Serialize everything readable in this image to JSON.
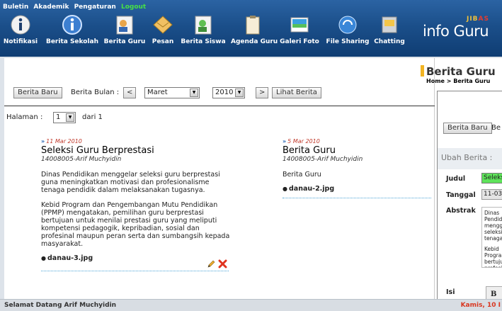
{
  "top_menu": {
    "items": [
      "Buletin",
      "Akademik",
      "Pengaturan"
    ],
    "logout": "Logout"
  },
  "nav": [
    {
      "label": "Notifikasi",
      "icon": "info-icon"
    },
    {
      "label": "Berita Sekolah",
      "icon": "info-circle-icon"
    },
    {
      "label": "Berita Guru",
      "icon": "teacher-news-icon"
    },
    {
      "label": "Pesan",
      "icon": "envelope-icon"
    },
    {
      "label": "Berita Siswa",
      "icon": "student-news-icon"
    },
    {
      "label": "Agenda Guru",
      "icon": "clipboard-icon"
    },
    {
      "label": "Galeri Foto",
      "icon": "photo-gallery-icon"
    },
    {
      "label": "File Sharing",
      "icon": "file-sharing-icon"
    },
    {
      "label": "Chatting",
      "icon": "chat-icon"
    }
  ],
  "logo": {
    "top": "JIB",
    "top_accent": "AS",
    "main": "info Guru"
  },
  "toolbar": {
    "berita_baru": "Berita Baru",
    "berita_bulan_label": "Berita Bulan :",
    "prev": "<",
    "month": "Maret",
    "year": "2010",
    "next": ">",
    "lihat_berita": "Lihat Berita"
  },
  "pagination": {
    "label": "Halaman :",
    "page": "1",
    "of": "dari 1"
  },
  "articles": [
    {
      "date": "11 Mar 2010",
      "title": "Seleksi Guru Berprestasi",
      "author": "14008005-Arif Muchyidin",
      "paragraphs": [
        "Dinas Pendidikan menggelar seleksi guru berprestasi guna meningkatkan motivasi dan profesionalisme tenaga pendidik dalam melaksanakan tugasnya.",
        "Kebid Program dan Pengembangan Mutu Pendidikan (PPMP) mengatakan, pemilihan guru berprestasi bertujuan untuk menilai prestasi guru yang meliputi kompetensi pedagogik, kepribadian, sosial dan profesinal maupun peran serta dan sumbangsih kepada masyarakat."
      ],
      "attachment": "danau-3.jpg"
    },
    {
      "date": "5 Mar 2010",
      "title": "Berita Guru",
      "author": "14008005-Arif Muchyidin",
      "paragraphs": [
        "Berita Guru"
      ],
      "attachment": "danau-2.jpg"
    }
  ],
  "right": {
    "title": "Berita Guru",
    "breadcrumb": "Home >  Berita Guru",
    "berita_baru": "Berita Baru",
    "berita_bulan_cut": "Be",
    "ubah_berita": "Ubah Berita :",
    "judul_label": "Judul",
    "judul_value": "Seleksi",
    "tanggal_label": "Tanggal",
    "tanggal_value": "11-03",
    "abstrak_label": "Abstrak",
    "abstrak_text_1": "Dinas Pendidikan menggelar seleksi tenaga",
    "abstrak_text_2": "Kebid Program bertujuan profesional",
    "isi_label": "Isi",
    "editor_bold": "B"
  },
  "footer": {
    "welcome": "Selamat Datang Arif Muchyidin",
    "date": "Kamis, 10 I"
  },
  "colors": {
    "header": "#1b4f8a",
    "accent": "#f2b423",
    "date_red": "#c0392b",
    "logout_green": "#46e046",
    "input_green": "#5ee35a"
  }
}
